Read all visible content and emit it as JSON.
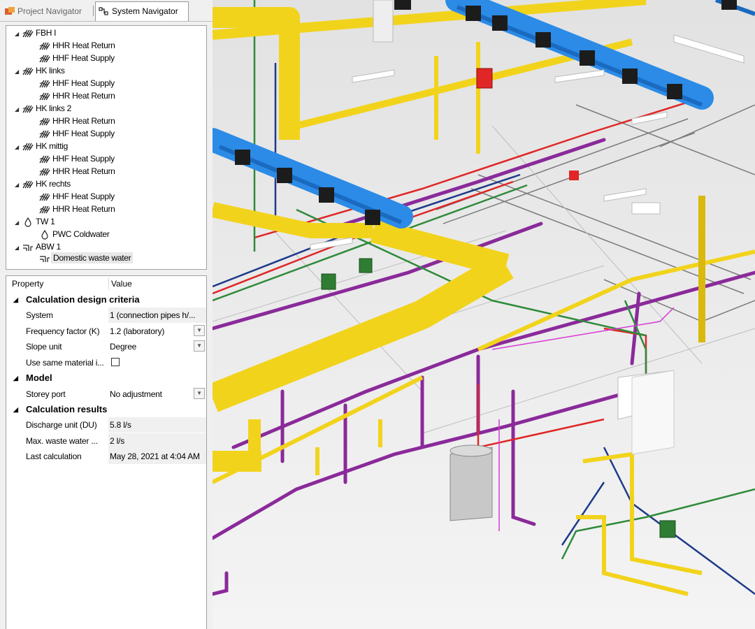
{
  "tabs": {
    "project_navigator": "Project Navigator",
    "system_navigator": "System Navigator"
  },
  "tree": {
    "fbh1": {
      "label": "FBH I",
      "children": [
        "HHR Heat Return",
        "HHF Heat Supply"
      ]
    },
    "hk_links": {
      "label": "HK links",
      "children": [
        "HHF Heat Supply",
        "HHR Heat Return"
      ]
    },
    "hk_links2": {
      "label": "HK links 2",
      "children": [
        "HHR Heat Return",
        "HHF Heat Supply"
      ]
    },
    "hk_mittig": {
      "label": "HK mittig",
      "children": [
        "HHF Heat Supply",
        "HHR Heat Return"
      ]
    },
    "hk_rechts": {
      "label": "HK rechts",
      "children": [
        "HHF Heat Supply",
        "HHR Heat Return"
      ]
    },
    "tw1": {
      "label": "TW 1",
      "children": [
        "PWC Coldwater"
      ]
    },
    "abw1": {
      "label": "ABW 1",
      "children": [
        "Domestic waste water"
      ]
    }
  },
  "properties": {
    "header_property": "Property",
    "header_value": "Value",
    "cat_design": "Calculation design criteria",
    "system_name": "System",
    "system_value": "1 (connection pipes h/...",
    "freq_name": "Frequency factor (K)",
    "freq_value": "1.2 (laboratory)",
    "slope_name": "Slope unit",
    "slope_value": "Degree",
    "same_material_name": "Use same material i...",
    "same_material_checked": false,
    "cat_model": "Model",
    "storey_name": "Storey port",
    "storey_value": "No adjustment",
    "cat_results": "Calculation results",
    "du_name": "Discharge unit (DU)",
    "du_value": "5.8 l/s",
    "waste_name": "Max. waste water ...",
    "waste_value": "2 l/s",
    "lastcalc_name": "Last calculation",
    "lastcalc_value": "May 28, 2021 at 4:04 AM"
  },
  "colors": {
    "duct_yellow": "#f2d31c",
    "duct_blue": "#2b8be6",
    "pipe_purple": "#8a2a9a",
    "pipe_red": "#e02626",
    "pipe_green": "#2f8a3a",
    "pipe_navy": "#1d3a8a"
  }
}
